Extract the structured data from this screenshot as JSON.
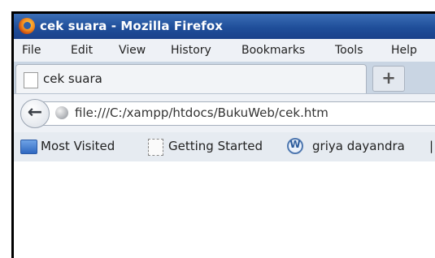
{
  "window": {
    "title": "cek suara - Mozilla Firefox"
  },
  "menu": [
    "File",
    "Edit",
    "View",
    "History",
    "Bookmarks",
    "Tools",
    "Help"
  ],
  "tab": {
    "label": "cek suara",
    "new_tab_symbol": "+"
  },
  "nav": {
    "back_symbol": "←",
    "url": "file:///C:/xampp/htdocs/BukuWeb/cek.htm"
  },
  "bookmarks": {
    "items": [
      "Most Visited",
      "Getting Started",
      "griya dayandra"
    ],
    "separator": "|"
  },
  "icons": {
    "app": "firefox-icon",
    "page": "page-icon",
    "site": "globe-icon",
    "most_visited": "folder-icon",
    "wordpress": "wordpress-icon"
  }
}
